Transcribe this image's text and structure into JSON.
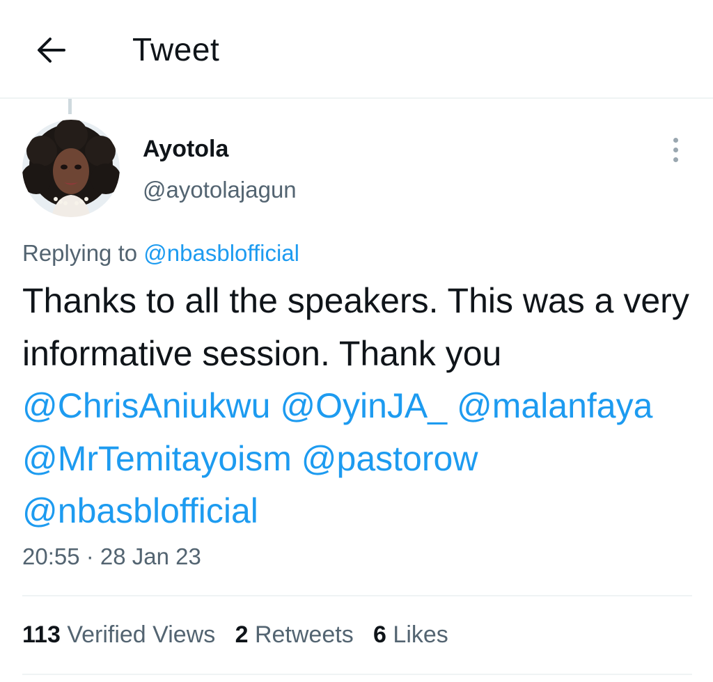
{
  "header": {
    "title": "Tweet",
    "back_icon": "arrow-left-icon"
  },
  "author": {
    "display_name": "Ayotola",
    "handle": "@ayotolajagun",
    "avatar_icon": "avatar-photo"
  },
  "more_icon": "more-vertical-icon",
  "tweet": {
    "replying_prefix": "Replying to",
    "replying_to": "@nbasblofficial",
    "text_intro": "Thanks to all the speakers.  This was a very informative session.  Thank you",
    "mentions": [
      "@ChrisAniukwu",
      "@OyinJA_",
      "@malanfaya",
      "@MrTemitayoism",
      "@pastorow",
      "@nbasblofficial"
    ],
    "timestamp": "20:55 · 28 Jan 23"
  },
  "stats": {
    "views_count": "113",
    "views_label": "Verified Views",
    "retweets_count": "2",
    "retweets_label": "Retweets",
    "likes_count": "6",
    "likes_label": "Likes"
  },
  "colors": {
    "link": "#1d9bf0",
    "text": "#0f1419",
    "secondary": "#536471",
    "divider": "#eff3f4"
  }
}
